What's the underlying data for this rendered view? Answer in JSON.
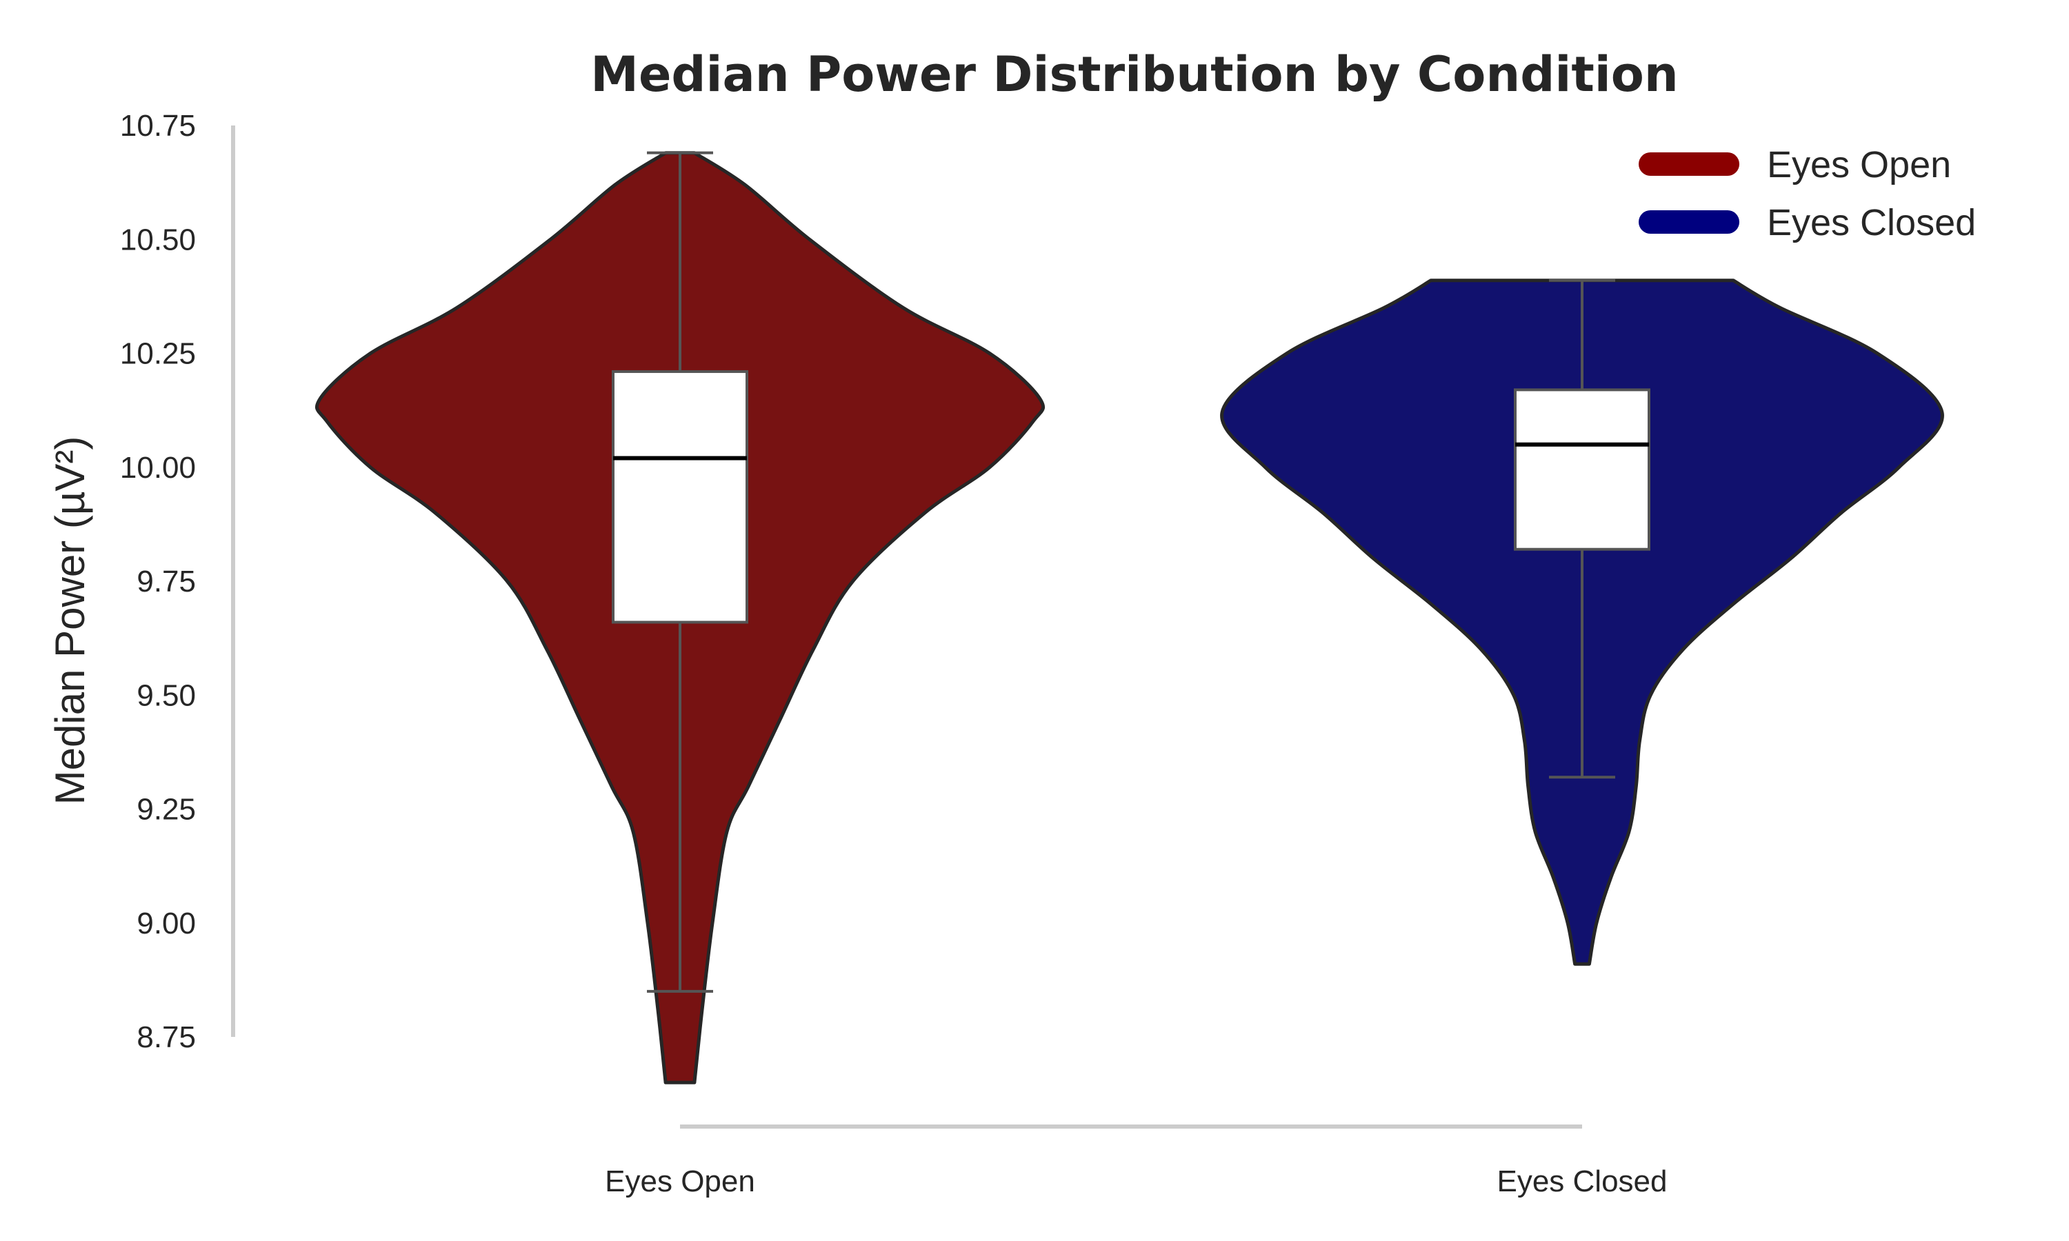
{
  "chart_data": {
    "type": "violin",
    "title": "Median Power Distribution by Condition",
    "xlabel": "",
    "ylabel": "Median Power (µV²)",
    "ylim": [
      8.75,
      10.75
    ],
    "yticks": [
      "8.75",
      "9.00",
      "9.25",
      "9.50",
      "9.75",
      "10.00",
      "10.25",
      "10.50",
      "10.75"
    ],
    "categories": [
      "Eyes Open",
      "Eyes Closed"
    ],
    "grid": false,
    "legend_position": "top-right",
    "series": [
      {
        "name": "Eyes Open",
        "color": "#8b0000",
        "fill": "#771212",
        "min": 8.85,
        "q1": 9.66,
        "median": 10.02,
        "q3": 10.21,
        "max": 10.69,
        "kde_min": 8.65,
        "kde_max": 10.69,
        "density": [
          [
            8.65,
            0.04
          ],
          [
            8.8,
            0.06
          ],
          [
            9.0,
            0.09
          ],
          [
            9.2,
            0.13
          ],
          [
            9.3,
            0.19
          ],
          [
            9.45,
            0.28
          ],
          [
            9.6,
            0.37
          ],
          [
            9.75,
            0.48
          ],
          [
            9.9,
            0.68
          ],
          [
            10.0,
            0.86
          ],
          [
            10.1,
            0.98
          ],
          [
            10.15,
            1.0
          ],
          [
            10.25,
            0.86
          ],
          [
            10.35,
            0.62
          ],
          [
            10.5,
            0.36
          ],
          [
            10.62,
            0.18
          ],
          [
            10.69,
            0.04
          ]
        ]
      },
      {
        "name": "Eyes Closed",
        "color": "#00007f",
        "fill": "#11116e",
        "min": 9.32,
        "q1": 9.82,
        "median": 10.05,
        "q3": 10.17,
        "max": 10.41,
        "kde_min": 8.91,
        "kde_max": 10.41,
        "density": [
          [
            8.91,
            0.02
          ],
          [
            9.0,
            0.04
          ],
          [
            9.1,
            0.08
          ],
          [
            9.2,
            0.13
          ],
          [
            9.3,
            0.15
          ],
          [
            9.4,
            0.16
          ],
          [
            9.5,
            0.19
          ],
          [
            9.6,
            0.28
          ],
          [
            9.7,
            0.42
          ],
          [
            9.8,
            0.58
          ],
          [
            9.9,
            0.72
          ],
          [
            10.0,
            0.88
          ],
          [
            10.12,
            1.0
          ],
          [
            10.25,
            0.82
          ],
          [
            10.35,
            0.55
          ],
          [
            10.41,
            0.42
          ]
        ]
      }
    ]
  }
}
